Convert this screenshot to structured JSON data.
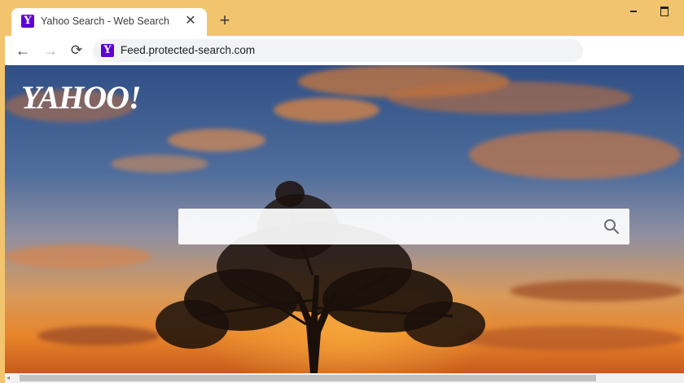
{
  "browser": {
    "tab": {
      "title": "Yahoo Search - Web Search",
      "favicon_letter": "Y",
      "close_glyph": "✕"
    },
    "new_tab_glyph": "+",
    "toolbar": {
      "back_glyph": "←",
      "forward_glyph": "→",
      "reload_glyph": "⟳",
      "url": "Feed.protected-search.com",
      "favicon_letter": "Y"
    }
  },
  "page": {
    "logo": "YAHOO!",
    "search": {
      "placeholder": "",
      "value": ""
    }
  },
  "colors": {
    "frame": "#f2c46d",
    "yahoo_purple": "#5f01d1"
  },
  "icons": [
    "yahoo-favicon-icon",
    "close-icon",
    "plus-icon",
    "back-arrow-icon",
    "forward-arrow-icon",
    "reload-icon",
    "search-icon",
    "minimize-icon",
    "maximize-icon",
    "scroll-left-icon"
  ]
}
